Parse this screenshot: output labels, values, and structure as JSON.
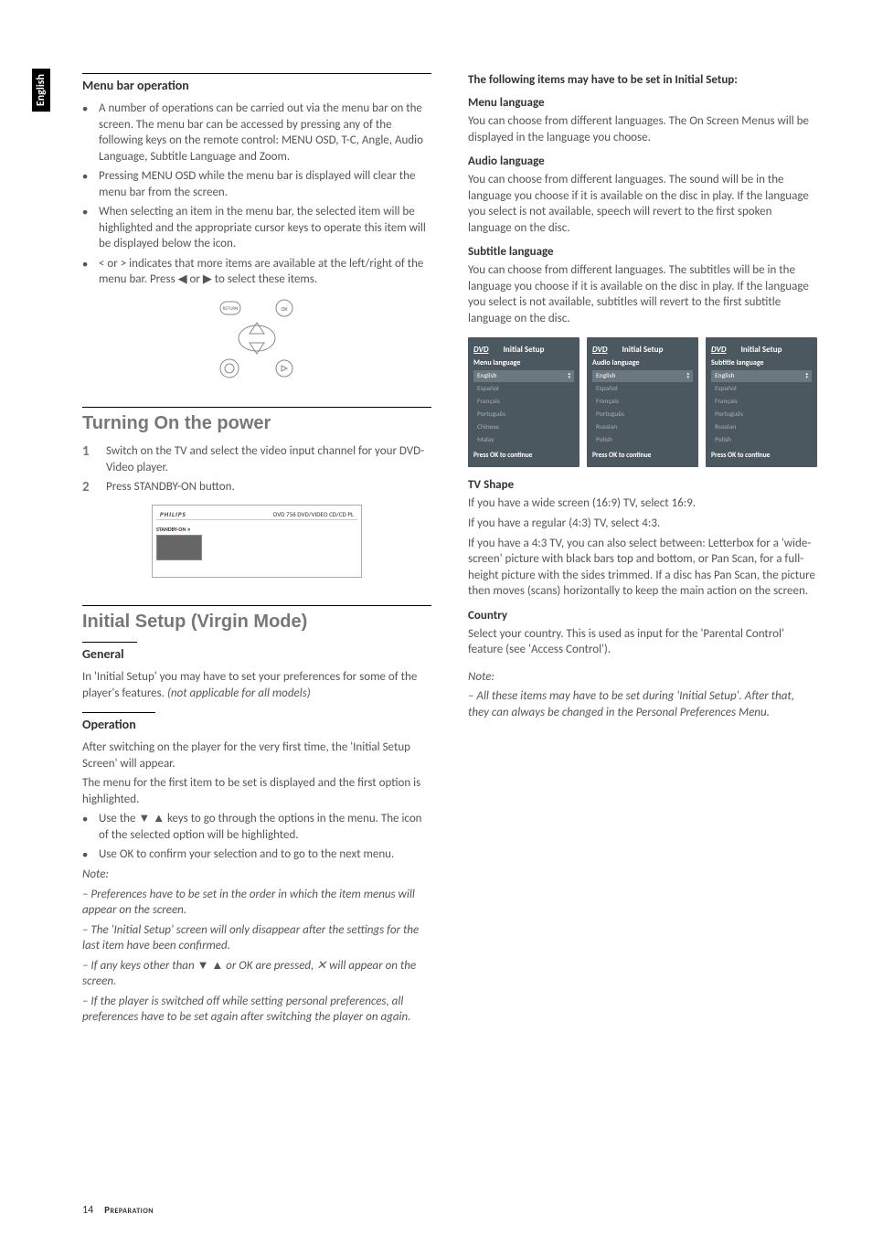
{
  "language_tab": "English",
  "left": {
    "menu_bar": {
      "title": "Menu bar operation",
      "items": [
        "A number of operations can be carried out via the menu bar on the screen. The menu bar can be accessed by pressing any of the following keys on the remote control: MENU OSD, T-C, Angle, Audio Language, Subtitle Language and Zoom.",
        "Pressing MENU OSD while the menu bar is displayed will clear the menu bar from the screen.",
        "When selecting an item in the menu bar, the selected item will be highlighted and the appropriate cursor keys to operate this item will be displayed below the icon.",
        "< or > indicates that more items are available at the left/right of the menu bar. Press ◀ or ▶ to select these items."
      ]
    },
    "power": {
      "title": "Turning On the power",
      "steps": [
        "Switch on the TV and select the video input channel for your DVD- Video player.",
        "Press STANDBY-ON button."
      ]
    },
    "device": {
      "brand": "PHILIPS",
      "model": "DVD 756  DVD/VIDEO CD/CD PL",
      "standby": "STANDBY-ON"
    },
    "virgin": {
      "title": "Initial Setup (Virgin Mode)",
      "general_heading": "General",
      "general_text": "In 'Initial Setup' you may have to set your preferences for some of the player's features.",
      "general_note": " (not applicable for all models)",
      "operation_heading": "Operation",
      "operation_p1": "After switching on the player for the very first time, the 'Initial Setup Screen' will appear.",
      "operation_p2": "The menu for the first item to be set is displayed and the first option is highlighted.",
      "bullets": [
        "Use the ▼ ▲ keys to go through the options in the menu. The icon of the selected option will be highlighted.",
        "Use OK to confirm your selection and to go to the next menu."
      ],
      "note_label": "Note:",
      "notes": [
        "Preferences have to be set in the order in which the item menus will appear on the screen.",
        "The 'Initial Setup' screen will only disappear after the settings for the last item have been confirmed.",
        "If any keys other than ▼ ▲ or OK are pressed, ✕ will appear on the screen.",
        "If the player is switched off while setting personal preferences, all preferences have to be set again after switching the player on again."
      ]
    }
  },
  "right": {
    "following_heading": "The following items may have to be set in Initial Setup:",
    "menu_lang": {
      "heading": "Menu language",
      "text": "You can choose from different languages. The On Screen Menus will be displayed in the language you choose."
    },
    "audio_lang": {
      "heading": "Audio language",
      "text": "You can choose from different languages. The sound will be in the language you choose if it is available on the disc in play. If the language you select is not available, speech will revert to the first spoken language on the disc."
    },
    "subtitle_lang": {
      "heading": "Subtitle language",
      "text": "You can choose from different languages. The subtitles will be in the language you choose if it is available on the disc in play. If the language you select is not available, subtitles will revert to the first subtitle language on the disc."
    },
    "screens": {
      "header": "Initial Setup",
      "footer": "Press OK to continue",
      "s1": {
        "title": "Menu language",
        "options": [
          "English",
          "Español",
          "Français",
          "Português",
          "Chinese",
          "Malay"
        ]
      },
      "s2": {
        "title": "Audio language",
        "options": [
          "English",
          "Español",
          "Français",
          "Português",
          "Russian",
          "Polish"
        ]
      },
      "s3": {
        "title": "Subtitle language",
        "options": [
          "English",
          "Español",
          "Français",
          "Português",
          "Russian",
          "Polish"
        ]
      }
    },
    "tv_shape": {
      "heading": "TV Shape",
      "p1": "If you have a wide screen (16:9) TV, select 16:9.",
      "p2": "If you have a regular (4:3) TV, select 4:3.",
      "p3": "If you have a 4:3 TV, you can also select between: Letterbox for a 'wide-screen' picture with black bars top and bottom, or Pan Scan, for a full-height picture with the sides trimmed. If a disc has Pan Scan, the picture then moves (scans) horizontally to keep the main action on the screen."
    },
    "country": {
      "heading": "Country",
      "text": "Select your country. This is used as input for the 'Parental Control' feature (see 'Access Control')."
    },
    "note_label": "Note:",
    "note_text": "All these items may have to be set during 'Initial Setup'. After that, they can always be changed in the Personal Preferences Menu."
  },
  "footer": {
    "page": "14",
    "title": "Preparation"
  }
}
